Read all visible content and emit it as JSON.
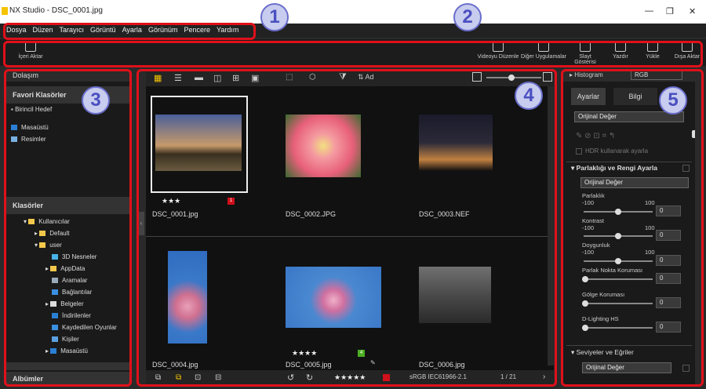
{
  "app": {
    "title": "NX Studio - DSC_0001.jpg"
  },
  "menu": [
    "Dosya",
    "Düzen",
    "Tarayıcı",
    "Görüntü",
    "Ayarla",
    "Görünüm",
    "Pencere",
    "Yardım"
  ],
  "toolbar": {
    "import": "İçeri Aktar",
    "video": "Videoyu Düzenle",
    "other_apps": "Diğer Uygulamalar",
    "slideshow": "Slayt Gösterisi",
    "print": "Yazdır",
    "upload": "Yükle",
    "export": "Dışa Aktar"
  },
  "nav": {
    "header": "Dolaşım",
    "favorites_header": "Favori Klasörler",
    "primary_target": "Birincil Hedef",
    "desktop": "Masaüstü",
    "pictures": "Resimler",
    "folders_header": "Klasörler",
    "albums_header": "Albümler"
  },
  "folders": [
    "Kullanıcılar",
    "Default",
    "user",
    "3D Nesneler",
    "AppData",
    "Aramalar",
    "Bağlantılar",
    "Belgeler",
    "İndirilenler",
    "Kaydedilen Oyunlar",
    "Kişiler",
    "Masaüstü"
  ],
  "browser": {
    "sort": "Ad",
    "page": "1 / 21",
    "color_profile": "sRGB IEC61966-2.1"
  },
  "thumbs": [
    {
      "name": "DSC_0001.jpg",
      "stars": "★★★",
      "badge": "1",
      "badge_color": "#d0101a"
    },
    {
      "name": "DSC_0002.JPG",
      "stars": "",
      "badge": "",
      "badge_color": ""
    },
    {
      "name": "DSC_0003.NEF",
      "stars": "",
      "badge": "",
      "badge_color": ""
    },
    {
      "name": "DSC_0004.jpg",
      "stars": "",
      "badge": "",
      "badge_color": ""
    },
    {
      "name": "DSC_0005.jpg",
      "stars": "★★★★",
      "badge": "4",
      "badge_color": "#4caf22"
    },
    {
      "name": "DSC_0006.jpg",
      "stars": "",
      "badge": "",
      "badge_color": ""
    }
  ],
  "right": {
    "histogram": "Histogram",
    "rgb": "RGB",
    "tab_adjust": "Ayarlar",
    "tab_info": "Bilgi",
    "preset": "Orijinal Değer",
    "hdr": "HDR kullanarak ayarla",
    "section1": "Parlaklığı ve Rengi Ayarla",
    "section1_preset": "Orijinal Değer",
    "brightness": "Parlaklık",
    "contrast": "Kontrast",
    "saturation": "Doygunluk",
    "highlight": "Parlak Nokta Koruması",
    "shadow": "Gölge Koruması",
    "dlighting": "D-Lighting HS",
    "min": "-100",
    "max": "100",
    "zero": "0",
    "section2": "Seviyeler ve Eğriler",
    "section2_preset": "Orijinal Değer"
  },
  "callouts": [
    "1",
    "2",
    "3",
    "4",
    "5"
  ]
}
